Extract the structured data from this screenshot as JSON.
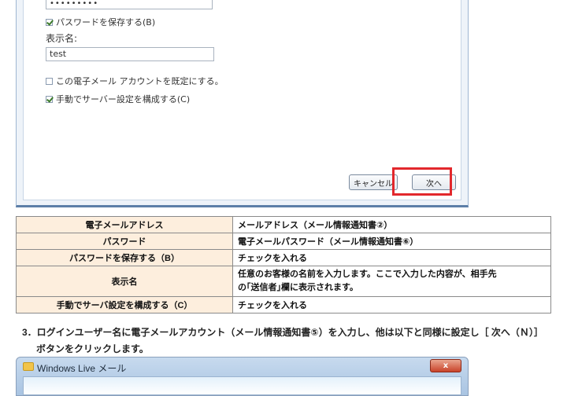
{
  "dialog": {
    "password_masked": "•••••••••",
    "save_password_label": "パスワードを保存する(B)",
    "save_password_checked": true,
    "display_name_label": "表示名:",
    "display_name_value": "test",
    "default_account_label": "この電子メール アカウントを既定にする。",
    "default_account_checked": false,
    "manual_config_label": "手動でサーバー設定を構成する(C)",
    "manual_config_checked": true,
    "cancel_label": "キャンセル",
    "next_label": "次へ",
    "highlight_color": "#e2282c"
  },
  "table": {
    "rows": [
      {
        "key": "電子メールアドレス",
        "value": "メールアドレス（メール情報通知書②）"
      },
      {
        "key": "パスワード",
        "value": "電子メールパスワード（メール情報通知書⑥）"
      },
      {
        "key": "パスワードを保存する（B）",
        "value": "チェックを入れる"
      },
      {
        "key": "表示名",
        "value_line1": "任意のお客様の名前を入力します。ここで入力した内容が、相手先",
        "value_line2": "の｢送信者｣欄に表示されます。"
      },
      {
        "key": "手動でサーバ設定を構成する（C）",
        "value": "チェックを入れる"
      }
    ]
  },
  "step": {
    "line1": "3．ログインユーザー名に電子メールアカウント（メール情報通知書⑤）を入力し、他は以下と同様に設定し［ 次へ（Ｎ）］",
    "line2": "ボタンをクリックします。"
  },
  "window": {
    "title": "Windows Live メール",
    "close_label": "x"
  }
}
